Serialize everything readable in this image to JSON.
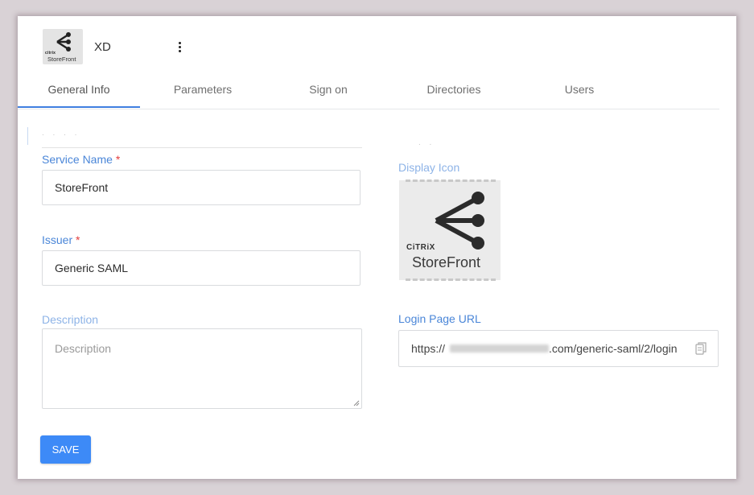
{
  "app": {
    "name": "XD",
    "logo_brand": "citrix",
    "logo_product": "StoreFront"
  },
  "tabs": [
    {
      "label": "General Info",
      "active": true
    },
    {
      "label": "Parameters",
      "active": false
    },
    {
      "label": "Sign on",
      "active": false
    },
    {
      "label": "Directories",
      "active": false
    },
    {
      "label": "Users",
      "active": false
    }
  ],
  "form": {
    "service_name": {
      "label": "Service Name",
      "required_mark": "*",
      "value": "StoreFront"
    },
    "issuer": {
      "label": "Issuer",
      "required_mark": "*",
      "value": "Generic SAML"
    },
    "description": {
      "label": "Description",
      "placeholder": "Description",
      "value": ""
    },
    "save_label": "SAVE"
  },
  "display_icon": {
    "label": "Display Icon",
    "brand": "CiTRiX",
    "product": "StoreFront"
  },
  "login_url": {
    "label": "Login Page URL",
    "prefix": "https://",
    "suffix": ".com/generic-saml/2/login"
  },
  "colors": {
    "accent": "#3d8af7",
    "label": "#4a86d8",
    "required": "#e23c3c"
  }
}
